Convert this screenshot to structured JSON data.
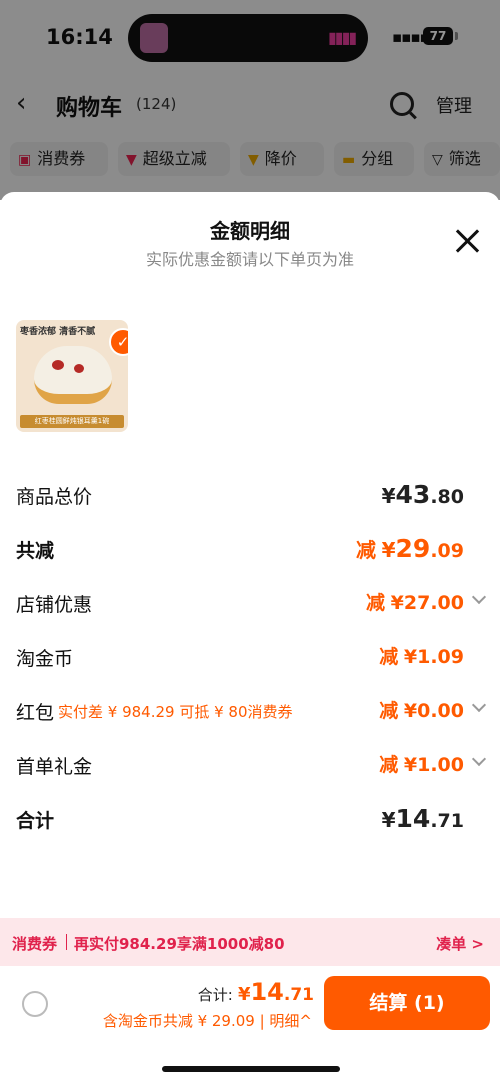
{
  "status": {
    "time": "16:14",
    "battery": "77"
  },
  "nav": {
    "title": "购物车",
    "count": "(124)",
    "manage": "管理"
  },
  "filters": [
    {
      "label": "消费券",
      "icon": "coupon-icon"
    },
    {
      "label": "超级立减",
      "icon": "arrow-down-icon"
    },
    {
      "label": "降价",
      "icon": "price-down-icon"
    },
    {
      "label": "分组",
      "icon": "folder-icon"
    },
    {
      "label": "筛选",
      "icon": "filter-icon"
    }
  ],
  "sheet": {
    "title": "金额明细",
    "subtitle": "实际优惠金额请以下单页为准"
  },
  "product": {
    "banner": "枣香浓郁 清香不腻",
    "footer": "红枣桂圆鲜炖银耳羹1碗"
  },
  "rows": {
    "total_price": {
      "label": "商品总价",
      "prefix": "",
      "sym": "¥",
      "int": "43",
      "dec": ".80"
    },
    "total_reduce": {
      "label": "共减",
      "prefix": "减",
      "sym": "¥",
      "int": "29",
      "dec": ".09"
    },
    "shop_discount": {
      "label": "店铺优惠",
      "prefix": "减",
      "sym": "¥",
      "int": "27",
      "dec": ".00"
    },
    "gold_coin": {
      "label": "淘金币",
      "prefix": "减",
      "sym": "¥",
      "int": "1",
      "dec": ".09"
    },
    "red_packet": {
      "label": "红包",
      "note": "实付差 ¥ 984.29 可抵 ¥ 80消费券",
      "prefix": "减",
      "sym": "¥",
      "int": "0",
      "dec": ".00"
    },
    "first_gift": {
      "label": "首单礼金",
      "prefix": "减",
      "sym": "¥",
      "int": "1",
      "dec": ".00"
    },
    "sum": {
      "label": "合计",
      "prefix": "",
      "sym": "¥",
      "int": "14",
      "dec": ".71"
    }
  },
  "coupon_bar": {
    "tag": "消费券",
    "text": "再实付984.29享满1000减80",
    "link": "凑单 >"
  },
  "footer": {
    "total_label": "合计:",
    "sym": "¥",
    "int": "14",
    "dec": ".71",
    "sub": "含淘金币共减 ¥ 29.09 | 明细^",
    "checkout": "结算 (1)"
  },
  "colors": {
    "accent": "#ff5a00",
    "coupon": "#e0224c"
  }
}
